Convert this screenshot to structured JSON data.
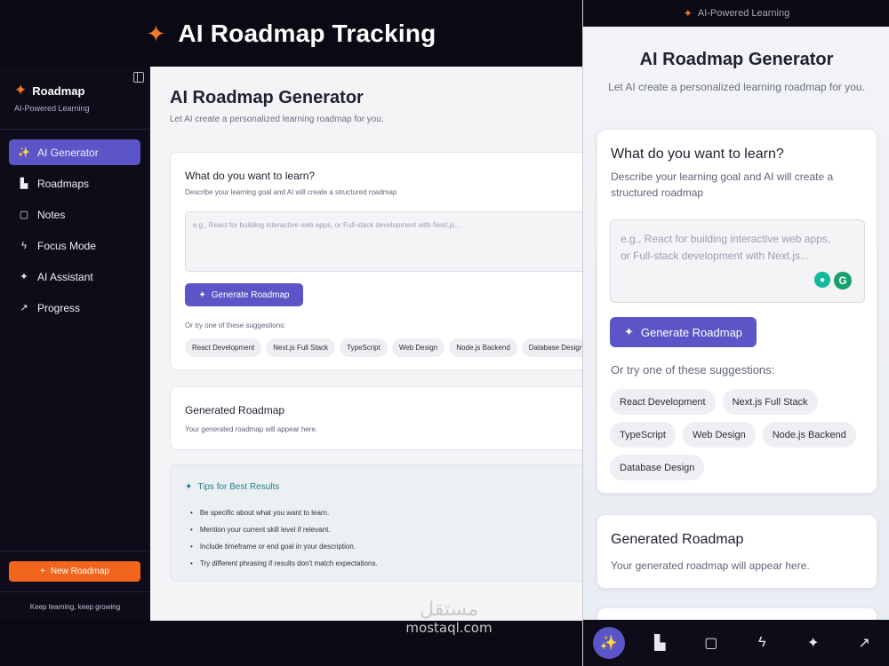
{
  "banner": {
    "title": "AI Roadmap Tracking",
    "icon": "sparkles-icon"
  },
  "sidebar": {
    "brand_title": "Roadmap",
    "brand_subtitle": "AI-Powered Learning",
    "items": [
      {
        "label": "AI Generator",
        "icon": "wand-icon",
        "glyph": "✨",
        "active": true
      },
      {
        "label": "Roadmaps",
        "icon": "bar-chart-icon",
        "glyph": "▙",
        "active": false
      },
      {
        "label": "Notes",
        "icon": "book-icon",
        "glyph": "▢",
        "active": false
      },
      {
        "label": "Focus Mode",
        "icon": "lightning-icon",
        "glyph": "ϟ",
        "active": false
      },
      {
        "label": "AI Assistant",
        "icon": "sparkles-icon",
        "glyph": "✦",
        "active": false
      },
      {
        "label": "Progress",
        "icon": "trend-icon",
        "glyph": "↗",
        "active": false
      }
    ],
    "new_button": "New Roadmap",
    "footer": "Keep learning, keep growing"
  },
  "main": {
    "title": "AI Roadmap Generator",
    "subtitle": "Let AI create a personalized learning roadmap for you.",
    "learn_card": {
      "heading": "What do you want to learn?",
      "description": "Describe your learning goal and AI will create a structured roadmap",
      "placeholder": "e.g., React for building interactive web apps, or Full-stack development with Next.js...",
      "generate_label": "Generate Roadmap",
      "suggest_label": "Or try one of these suggestions:",
      "suggestions": [
        "React Development",
        "Next.js Full Stack",
        "TypeScript",
        "Web Design",
        "Node.js Backend",
        "Database Design"
      ]
    },
    "result_card": {
      "heading": "Generated Roadmap",
      "text": "Your generated roadmap will appear here."
    },
    "tips": {
      "heading": "Tips for Best Results",
      "items": [
        "Be specific about what you want to learn.",
        "Mention your current skill level if relevant.",
        "Include timeframe or end goal in your description.",
        "Try different phrasing if results don't match expectations."
      ]
    }
  },
  "mobile": {
    "top_label": "AI-Powered Learning",
    "placeholder_line1": "e.g., React for building interactive web apps,",
    "placeholder_line2": "or Full-stack development with Next.js...",
    "description": "Describe your learning goal and AI will create a structured roadmap"
  },
  "watermark": {
    "arabic": "مستقل",
    "latin": "mostaql.com"
  },
  "colors": {
    "accent": "#5b55c8",
    "brand": "#f47a22",
    "orange_button": "#f2651c",
    "dark": "#0d0c18"
  }
}
